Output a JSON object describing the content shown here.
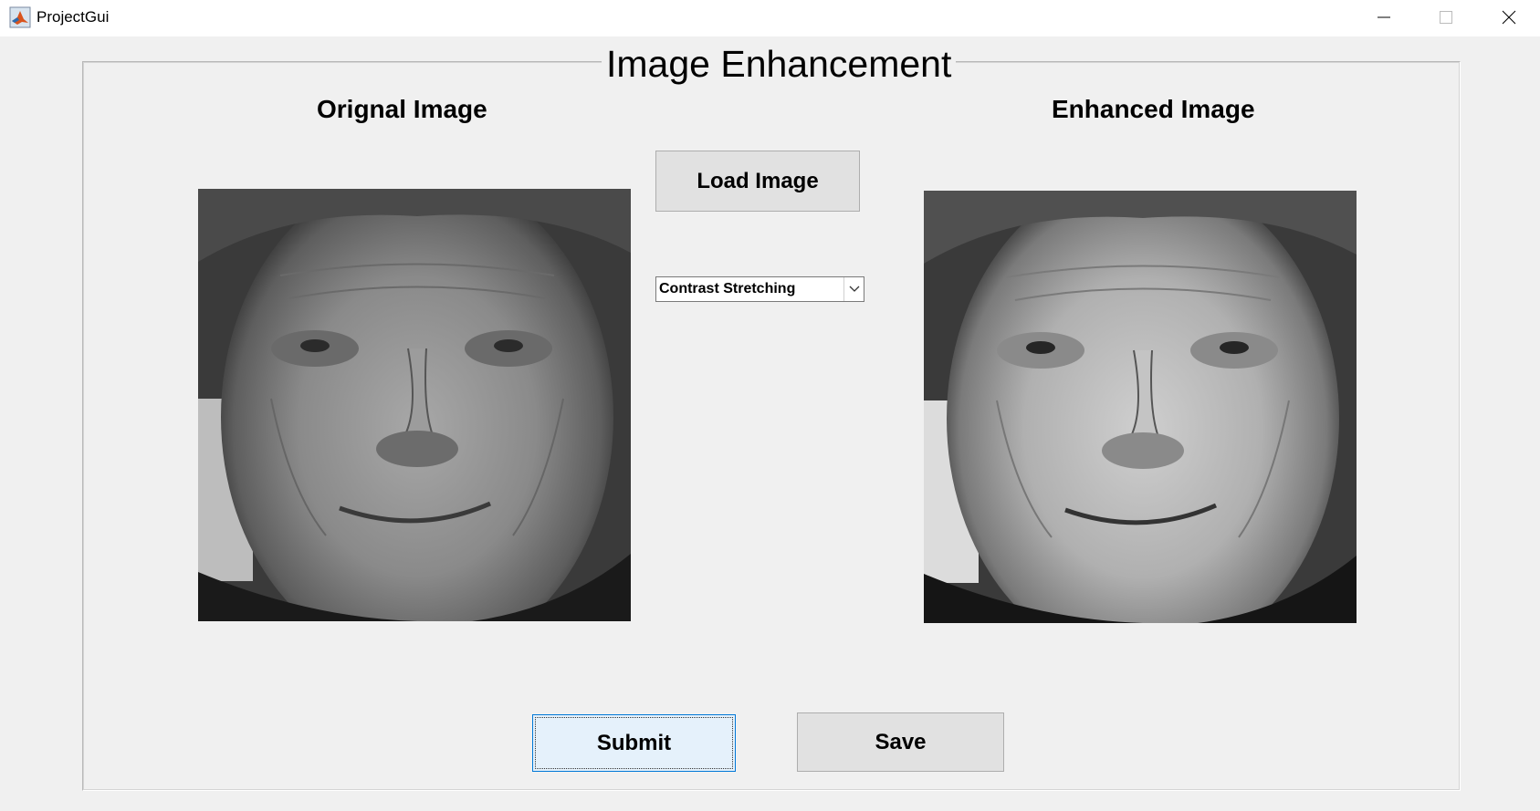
{
  "window": {
    "title": "ProjectGui",
    "icon": "matlab-icon",
    "controls": {
      "minimize": "minimize-icon",
      "maximize": "maximize-icon",
      "close": "close-icon"
    }
  },
  "panel": {
    "title": "Image Enhancement"
  },
  "original": {
    "label": "Orignal Image",
    "image": "grayscale portrait photo of an elderly woman"
  },
  "enhanced": {
    "label": "Enhanced Image",
    "image": "contrast-stretched grayscale portrait photo of an elderly woman"
  },
  "controls": {
    "load_label": "Load Image",
    "method_selected": "Contrast Stretching",
    "submit_label": "Submit",
    "save_label": "Save"
  },
  "colors": {
    "background": "#f0f0f0",
    "button": "#e1e1e1",
    "focus_border": "#0078d7",
    "focus_fill": "#e5f1fb"
  }
}
